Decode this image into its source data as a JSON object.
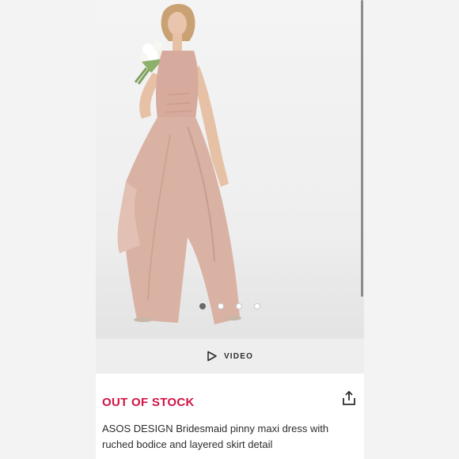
{
  "gallery": {
    "image_alt": "Model wearing blush pink halter neck maxi dress with layered skirt, holding a small white bouquet",
    "slides": 4,
    "active_slide": 1
  },
  "video": {
    "label": "VIDEO",
    "icon": "play-outline-icon"
  },
  "product": {
    "stock_status": "OUT OF STOCK",
    "title": "ASOS DESIGN Bridesmaid pinny maxi dress with ruched bodice and layered skirt detail",
    "share_icon": "share-icon"
  },
  "colors": {
    "stock_accent": "#d01345",
    "dress": "#d9b2a4",
    "video_bar": "#eeeeee"
  }
}
